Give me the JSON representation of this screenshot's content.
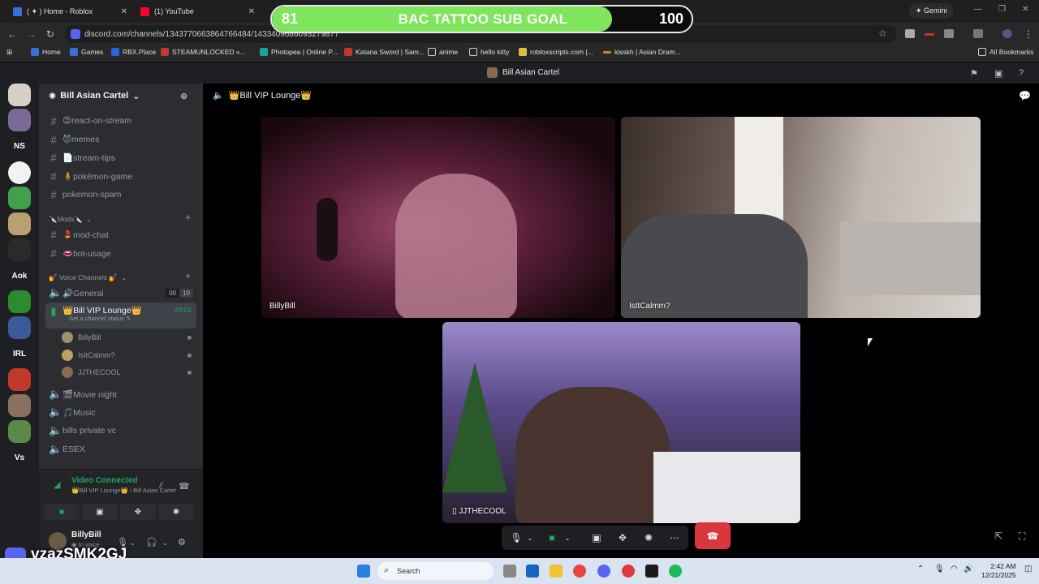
{
  "browser": {
    "tabs": [
      {
        "title": "( ✦ ) Home - Roblox",
        "color": "#3b6fd8"
      },
      {
        "title": "(1) YouTube",
        "color": "#ff0033"
      }
    ],
    "gemini_label": "✦ Gemini",
    "url": "discord.com/channels/1343770663864766484/1433409686093279877",
    "bookmarks": [
      "Home",
      "Games",
      "RBX.Place",
      "STEAMUNLOCKED »...",
      "Photopea | Online P...",
      "Katana Sword | Sam...",
      "anime",
      "hello kitty",
      "robloxscripts.com |...",
      "kisskh | Asian Dram...",
      "All Bookmarks"
    ]
  },
  "sub_goal": {
    "current": "81",
    "title": "BAC TATTOO SUB GOAL",
    "target": "100",
    "progress": 0.81,
    "color": "#7ee55c"
  },
  "discord": {
    "window_title": "Bill Asian Cartel",
    "server_rail": [
      "NS",
      "Aok",
      "IRL",
      "Vs"
    ],
    "server_name": "Bill Asian Cartel",
    "channels": [
      {
        "label": "😡react-on-stream"
      },
      {
        "label": "😈memes"
      },
      {
        "label": "📄stream-tips"
      },
      {
        "label": "🧍pokémon-game"
      },
      {
        "label": "pokemon-spam"
      }
    ],
    "mods_category": "🔪Mods🔪",
    "mod_channels": [
      {
        "label": "💄mod-chat"
      },
      {
        "label": "👄bot-usage"
      }
    ],
    "voice_category": "💅 Voice Channels 💅",
    "voice_channels": {
      "general": {
        "label": "🔊General",
        "count_a": "00",
        "count_b": "10"
      },
      "vip": {
        "label": "👑Bill VIP Lounge👑",
        "timer": "20:01",
        "status": "Set a channel status"
      },
      "members": [
        "BillyBill",
        "IsItCalmm?",
        "JJTHECOOL"
      ],
      "others": [
        "🎬Movie night",
        "🎵Music",
        "bills private vc",
        "ESEX"
      ]
    },
    "voice_panel": {
      "title": "Video Connected",
      "subtitle": "👑Bill VIP Lounge👑 / Bill Asian Cartel"
    },
    "user": {
      "name": "BillyBill",
      "status": "In voice"
    },
    "stage": {
      "channel_title": "👑Bill VIP Lounge👑",
      "tiles": [
        "BillyBill",
        "IsItCalmm?",
        "JJTHECOOL"
      ]
    }
  },
  "watermark": "vzazSMK2GJ",
  "taskbar": {
    "search_placeholder": "Search",
    "time": "2:42 AM",
    "date": "12/21/2025"
  }
}
